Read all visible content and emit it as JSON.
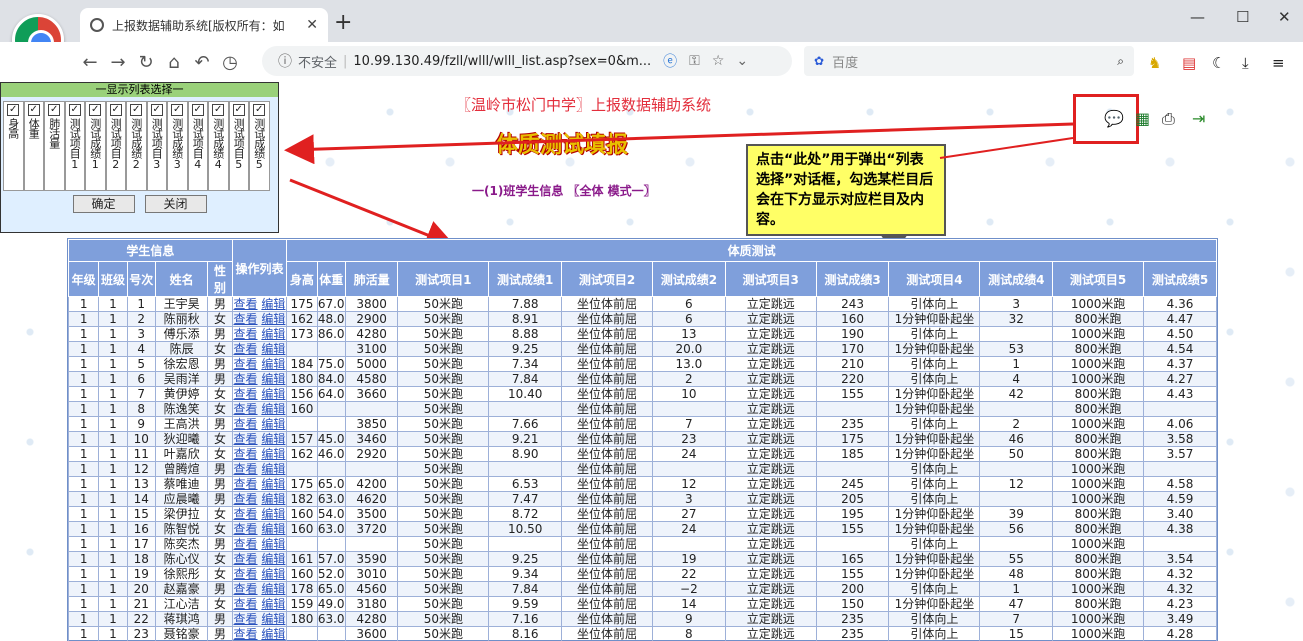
{
  "browser": {
    "tab_title": "上报数据辅助系统[版权所有：如",
    "url_security": "不安全",
    "url": "10.99.130.49/fzll/wlll/wlll_list.asp?sex=0&m...",
    "search_engine": "百度"
  },
  "popup": {
    "title": "一显示列表选择一",
    "columns": [
      {
        "label": "身高"
      },
      {
        "label": "体重"
      },
      {
        "label": "肺活量"
      },
      {
        "label": "测试项目1"
      },
      {
        "label": "测试成绩1"
      },
      {
        "label": "测试项目2"
      },
      {
        "label": "测试成绩2"
      },
      {
        "label": "测试项目3"
      },
      {
        "label": "测试成绩3"
      },
      {
        "label": "测试项目4"
      },
      {
        "label": "测试成绩4"
      },
      {
        "label": "测试项目5"
      },
      {
        "label": "测试成绩5"
      }
    ],
    "ok": "确定",
    "close": "关闭"
  },
  "page": {
    "system_title": "〖温岭市松门中学〗上报数据辅助系统",
    "main_title": "体质测试填报",
    "subtitle": "一(1)班学生信息 〖全体 模式一〗"
  },
  "callout": "点击“此处”用于弹出“列表选择”对话框，勾选某栏目后会在下方显示对应栏目及内容。",
  "table": {
    "group_student": "学生信息",
    "group_ops": "操作列表",
    "group_test": "体质测试",
    "headers": [
      "年级",
      "班级",
      "号次",
      "姓名",
      "性别",
      "身高",
      "体重",
      "肺活量",
      "测试项目1",
      "测试成绩1",
      "测试项目2",
      "测试成绩2",
      "测试项目3",
      "测试成绩3",
      "测试项目4",
      "测试成绩4",
      "测试项目5",
      "测试成绩5"
    ],
    "view": "查看",
    "edit": "编辑",
    "rows": [
      [
        "1",
        "1",
        "1",
        "王宇昊",
        "男",
        "175",
        "67.0",
        "3800",
        "50米跑",
        "7.88",
        "坐位体前屈",
        "6",
        "立定跳远",
        "243",
        "引体向上",
        "3",
        "1000米跑",
        "4.36"
      ],
      [
        "1",
        "1",
        "2",
        "陈丽秋",
        "女",
        "162",
        "48.0",
        "2900",
        "50米跑",
        "8.91",
        "坐位体前屈",
        "6",
        "立定跳远",
        "160",
        "1分钟仰卧起坐",
        "32",
        "800米跑",
        "4.47"
      ],
      [
        "1",
        "1",
        "3",
        "傅乐添",
        "男",
        "173",
        "86.0",
        "4280",
        "50米跑",
        "8.88",
        "坐位体前屈",
        "13",
        "立定跳远",
        "190",
        "引体向上",
        "",
        "1000米跑",
        "4.50"
      ],
      [
        "1",
        "1",
        "4",
        "陈辰",
        "女",
        "",
        "",
        "3100",
        "50米跑",
        "9.25",
        "坐位体前屈",
        "20.0",
        "立定跳远",
        "170",
        "1分钟仰卧起坐",
        "53",
        "800米跑",
        "4.54"
      ],
      [
        "1",
        "1",
        "5",
        "徐宏恩",
        "男",
        "184",
        "75.0",
        "5000",
        "50米跑",
        "7.34",
        "坐位体前屈",
        "13.0",
        "立定跳远",
        "210",
        "引体向上",
        "1",
        "1000米跑",
        "4.37"
      ],
      [
        "1",
        "1",
        "6",
        "吴雨洋",
        "男",
        "180",
        "84.0",
        "4580",
        "50米跑",
        "7.84",
        "坐位体前屈",
        "2",
        "立定跳远",
        "220",
        "引体向上",
        "4",
        "1000米跑",
        "4.27"
      ],
      [
        "1",
        "1",
        "7",
        "黄伊婷",
        "女",
        "156",
        "64.0",
        "3660",
        "50米跑",
        "10.40",
        "坐位体前屈",
        "10",
        "立定跳远",
        "155",
        "1分钟仰卧起坐",
        "42",
        "800米跑",
        "4.43"
      ],
      [
        "1",
        "1",
        "8",
        "陈逸笑",
        "女",
        "160",
        "",
        "",
        "50米跑",
        "",
        "坐位体前屈",
        "",
        "立定跳远",
        "",
        "1分钟仰卧起坐",
        "",
        "800米跑",
        ""
      ],
      [
        "1",
        "1",
        "9",
        "王高洪",
        "男",
        "",
        "",
        "3850",
        "50米跑",
        "7.66",
        "坐位体前屈",
        "7",
        "立定跳远",
        "235",
        "引体向上",
        "2",
        "1000米跑",
        "4.06"
      ],
      [
        "1",
        "1",
        "10",
        "狄迎曦",
        "女",
        "157",
        "45.0",
        "3460",
        "50米跑",
        "9.21",
        "坐位体前屈",
        "23",
        "立定跳远",
        "175",
        "1分钟仰卧起坐",
        "46",
        "800米跑",
        "3.58"
      ],
      [
        "1",
        "1",
        "11",
        "叶嘉欣",
        "女",
        "162",
        "46.0",
        "2920",
        "50米跑",
        "8.90",
        "坐位体前屈",
        "24",
        "立定跳远",
        "185",
        "1分钟仰卧起坐",
        "50",
        "800米跑",
        "3.57"
      ],
      [
        "1",
        "1",
        "12",
        "曾腾煊",
        "男",
        "",
        "",
        "",
        "50米跑",
        "",
        "坐位体前屈",
        "",
        "立定跳远",
        "",
        "引体向上",
        "",
        "1000米跑",
        ""
      ],
      [
        "1",
        "1",
        "13",
        "蔡唯迪",
        "男",
        "175",
        "65.0",
        "4200",
        "50米跑",
        "6.53",
        "坐位体前屈",
        "12",
        "立定跳远",
        "245",
        "引体向上",
        "12",
        "1000米跑",
        "4.58"
      ],
      [
        "1",
        "1",
        "14",
        "应晨曦",
        "男",
        "182",
        "63.0",
        "4620",
        "50米跑",
        "7.47",
        "坐位体前屈",
        "3",
        "立定跳远",
        "205",
        "引体向上",
        "",
        "1000米跑",
        "4.59"
      ],
      [
        "1",
        "1",
        "15",
        "梁伊拉",
        "女",
        "160",
        "54.0",
        "3500",
        "50米跑",
        "8.72",
        "坐位体前屈",
        "27",
        "立定跳远",
        "195",
        "1分钟仰卧起坐",
        "39",
        "800米跑",
        "3.40"
      ],
      [
        "1",
        "1",
        "16",
        "陈智悦",
        "女",
        "160",
        "63.0",
        "3720",
        "50米跑",
        "10.50",
        "坐位体前屈",
        "24",
        "立定跳远",
        "155",
        "1分钟仰卧起坐",
        "56",
        "800米跑",
        "4.38"
      ],
      [
        "1",
        "1",
        "17",
        "陈奕杰",
        "男",
        "",
        "",
        "",
        "50米跑",
        "",
        "坐位体前屈",
        "",
        "立定跳远",
        "",
        "引体向上",
        "",
        "1000米跑",
        ""
      ],
      [
        "1",
        "1",
        "18",
        "陈心仪",
        "女",
        "161",
        "57.0",
        "3590",
        "50米跑",
        "9.25",
        "坐位体前屈",
        "19",
        "立定跳远",
        "165",
        "1分钟仰卧起坐",
        "55",
        "800米跑",
        "3.54"
      ],
      [
        "1",
        "1",
        "19",
        "徐熙彤",
        "女",
        "160",
        "52.0",
        "3010",
        "50米跑",
        "9.34",
        "坐位体前屈",
        "22",
        "立定跳远",
        "155",
        "1分钟仰卧起坐",
        "48",
        "800米跑",
        "4.32"
      ],
      [
        "1",
        "1",
        "20",
        "赵嘉豪",
        "男",
        "178",
        "65.0",
        "4560",
        "50米跑",
        "7.84",
        "坐位体前屈",
        "−2",
        "立定跳远",
        "200",
        "引体向上",
        "1",
        "1000米跑",
        "4.32"
      ],
      [
        "1",
        "1",
        "21",
        "江心洁",
        "女",
        "159",
        "49.0",
        "3180",
        "50米跑",
        "9.59",
        "坐位体前屈",
        "14",
        "立定跳远",
        "150",
        "1分钟仰卧起坐",
        "47",
        "800米跑",
        "4.23"
      ],
      [
        "1",
        "1",
        "22",
        "蒋琪鸿",
        "男",
        "180",
        "63.0",
        "4280",
        "50米跑",
        "7.16",
        "坐位体前屈",
        "9",
        "立定跳远",
        "235",
        "引体向上",
        "7",
        "1000米跑",
        "3.49"
      ],
      [
        "1",
        "1",
        "23",
        "聂铭豪",
        "男",
        "",
        "",
        "3600",
        "50米跑",
        "8.16",
        "坐位体前屈",
        "8",
        "立定跳远",
        "235",
        "引体向上",
        "15",
        "1000米跑",
        "4.28"
      ]
    ]
  }
}
